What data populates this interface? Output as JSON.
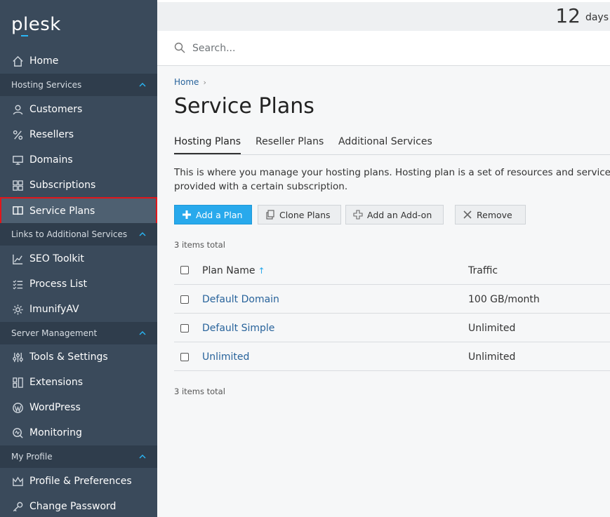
{
  "sidebar": {
    "logo": "plesk",
    "home": "Home",
    "sections": {
      "hosting": "Hosting Services",
      "links": "Links to Additional Services",
      "server": "Server Management",
      "profile": "My Profile"
    },
    "items": {
      "customers": "Customers",
      "resellers": "Resellers",
      "domains": "Domains",
      "subscriptions": "Subscriptions",
      "service_plans": "Service Plans",
      "seo_toolkit": "SEO Toolkit",
      "process_list": "Process List",
      "imunifyav": "ImunifyAV",
      "tools_settings": "Tools & Settings",
      "extensions": "Extensions",
      "wordpress": "WordPress",
      "monitoring": "Monitoring",
      "profile_preferences": "Profile & Preferences",
      "change_password": "Change Password"
    },
    "active_item": "service_plans",
    "colors": {
      "bg": "#3a4a5b",
      "section_bg": "#2f3d4c",
      "active_outline": "#e0161b"
    }
  },
  "topbar": {
    "days_number": "12",
    "days_label": "days"
  },
  "search": {
    "placeholder": "Search..."
  },
  "breadcrumb": {
    "home": "Home"
  },
  "page": {
    "title": "Service Plans",
    "tabs": [
      "Hosting Plans",
      "Reseller Plans",
      "Additional Services"
    ],
    "active_tab": 0,
    "description_line1": "This is where you manage your hosting plans. Hosting plan is a set of resources and services pro",
    "description_line2": "provided with a certain subscription."
  },
  "toolbar": {
    "add_plan": "Add a Plan",
    "clone_plans": "Clone Plans",
    "add_addon": "Add an Add-on",
    "remove": "Remove"
  },
  "items_total_top": "3 items total",
  "items_total_bottom": "3 items total",
  "table": {
    "columns": [
      "Plan Name",
      "Traffic"
    ],
    "sort_indicator": "↑",
    "rows": [
      {
        "name": "Default Domain",
        "traffic": "100 GB/month"
      },
      {
        "name": "Default Simple",
        "traffic": "Unlimited"
      },
      {
        "name": "Unlimited",
        "traffic": "Unlimited"
      }
    ]
  },
  "accent_colors": {
    "primary_button": "#28a9ec",
    "link": "#28639b"
  }
}
